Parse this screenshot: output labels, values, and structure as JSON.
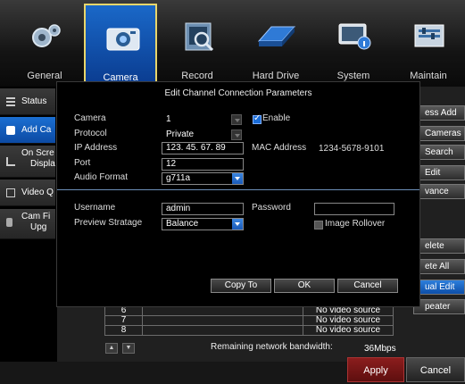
{
  "tabs": [
    {
      "label": "General",
      "icon": "gears-icon"
    },
    {
      "label": "Camera",
      "icon": "camera-icon"
    },
    {
      "label": "Record",
      "icon": "record-icon"
    },
    {
      "label": "Hard Drive",
      "icon": "hard-drive-icon"
    },
    {
      "label": "System",
      "icon": "system-icon"
    },
    {
      "label": "Maintain",
      "icon": "maintain-icon"
    }
  ],
  "sidebar": {
    "items": [
      {
        "label": "Status"
      },
      {
        "label": "Add Ca"
      },
      {
        "label_1": "On Scre",
        "label_2": "Displa"
      },
      {
        "label": "Video Q"
      },
      {
        "label_1": "Cam Fi",
        "label_2": "Upg"
      }
    ]
  },
  "right_buttons": [
    {
      "label": "ess Add"
    },
    {
      "label": "Cameras"
    },
    {
      "label": "Search"
    },
    {
      "label": "Edit"
    },
    {
      "label": "vance"
    },
    {
      "label": "elete"
    },
    {
      "label": "ete All"
    },
    {
      "label": "ual Edit"
    },
    {
      "label": "peater"
    }
  ],
  "dialog": {
    "title": "Edit Channel Connection Parameters",
    "camera_label": "Camera",
    "camera_value": "1",
    "enable_label": "Enable",
    "enable_checked": true,
    "protocol_label": "Protocol",
    "protocol_value": "Private",
    "ip_label": "IP Address",
    "ip_value": "123.  45.  67.  89",
    "mac_label": "MAC Address",
    "mac_value": "1234-5678-9101",
    "port_label": "Port",
    "port_value": "12",
    "audio_label": "Audio Format",
    "audio_value": "g711a",
    "username_label": "Username",
    "username_value": "admin",
    "password_label": "Password",
    "password_value": "",
    "preview_label": "Preview Stratage",
    "preview_value": "Balance",
    "rollover_label": "Image Rollover",
    "rollover_checked": false,
    "copy_to": "Copy To",
    "ok": "OK",
    "cancel": "Cancel"
  },
  "grid": {
    "rows": [
      {
        "num": "6",
        "source": "No video source"
      },
      {
        "num": "7",
        "source": "No video source"
      },
      {
        "num": "8",
        "source": "No video source"
      }
    ]
  },
  "bandwidth": {
    "label": "Remaining network bandwidth:",
    "value": "36Mbps"
  },
  "footer": {
    "apply": "Apply",
    "cancel": "Cancel"
  },
  "colors": {
    "accent_blue": "#1a68c8",
    "tab_border": "#e8d66c",
    "apply_red": "#8b1d1d"
  }
}
